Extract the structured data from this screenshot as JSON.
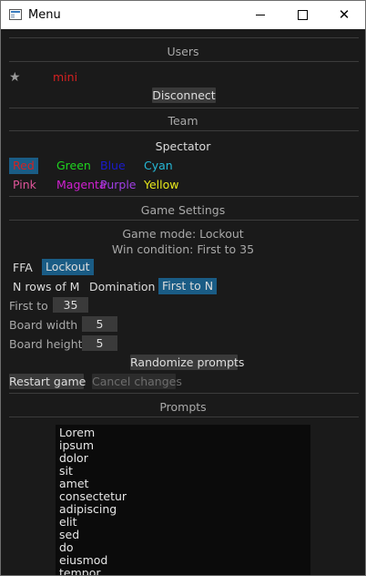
{
  "window": {
    "title": "Menu",
    "icon": "app-window-icon",
    "controls": [
      "minimize-icon",
      "maximize-icon",
      "close-icon"
    ]
  },
  "users": {
    "header": "Users",
    "list": [
      {
        "icon": "star-icon",
        "name": "mini",
        "color": "#d42121"
      }
    ],
    "disconnect_label": "Disconnect"
  },
  "team": {
    "header": "Team",
    "spectator_label": "Spectator",
    "colors": [
      {
        "label": "Red",
        "color": "#d42121",
        "selected": true
      },
      {
        "label": "Green",
        "color": "#1fd41f"
      },
      {
        "label": "Blue",
        "color": "#1a1acd"
      },
      {
        "label": "Cyan",
        "color": "#25b8d6"
      },
      {
        "label": "Pink",
        "color": "#e0559a"
      },
      {
        "label": "Magenta",
        "color": "#d120d1"
      },
      {
        "label": "Purple",
        "color": "#a23fe6"
      },
      {
        "label": "Yellow",
        "color": "#e8e81a"
      }
    ]
  },
  "game": {
    "header": "Game Settings",
    "mode_text": "Game mode: Lockout",
    "win_text": "Win condition: First to 35",
    "modes": [
      "FFA",
      "Lockout"
    ],
    "selected_mode": "Lockout",
    "win_conditions": [
      "N rows of M",
      "Domination",
      "First to N"
    ],
    "selected_win": "First to N",
    "first_to": {
      "label": "First to",
      "value": "35"
    },
    "board_width": {
      "label": "Board width",
      "value": "5"
    },
    "board_height": {
      "label": "Board height",
      "value": "5"
    },
    "randomize_label": "Randomize prompts",
    "restart_label": "Restart game",
    "cancel_label": "Cancel changes"
  },
  "prompts": {
    "header": "Prompts",
    "items": [
      "Lorem",
      "ipsum",
      "dolor",
      "sit",
      "amet",
      "consectetur",
      "adipiscing",
      "elit",
      "sed",
      "do",
      "eiusmod",
      "tempor"
    ]
  }
}
